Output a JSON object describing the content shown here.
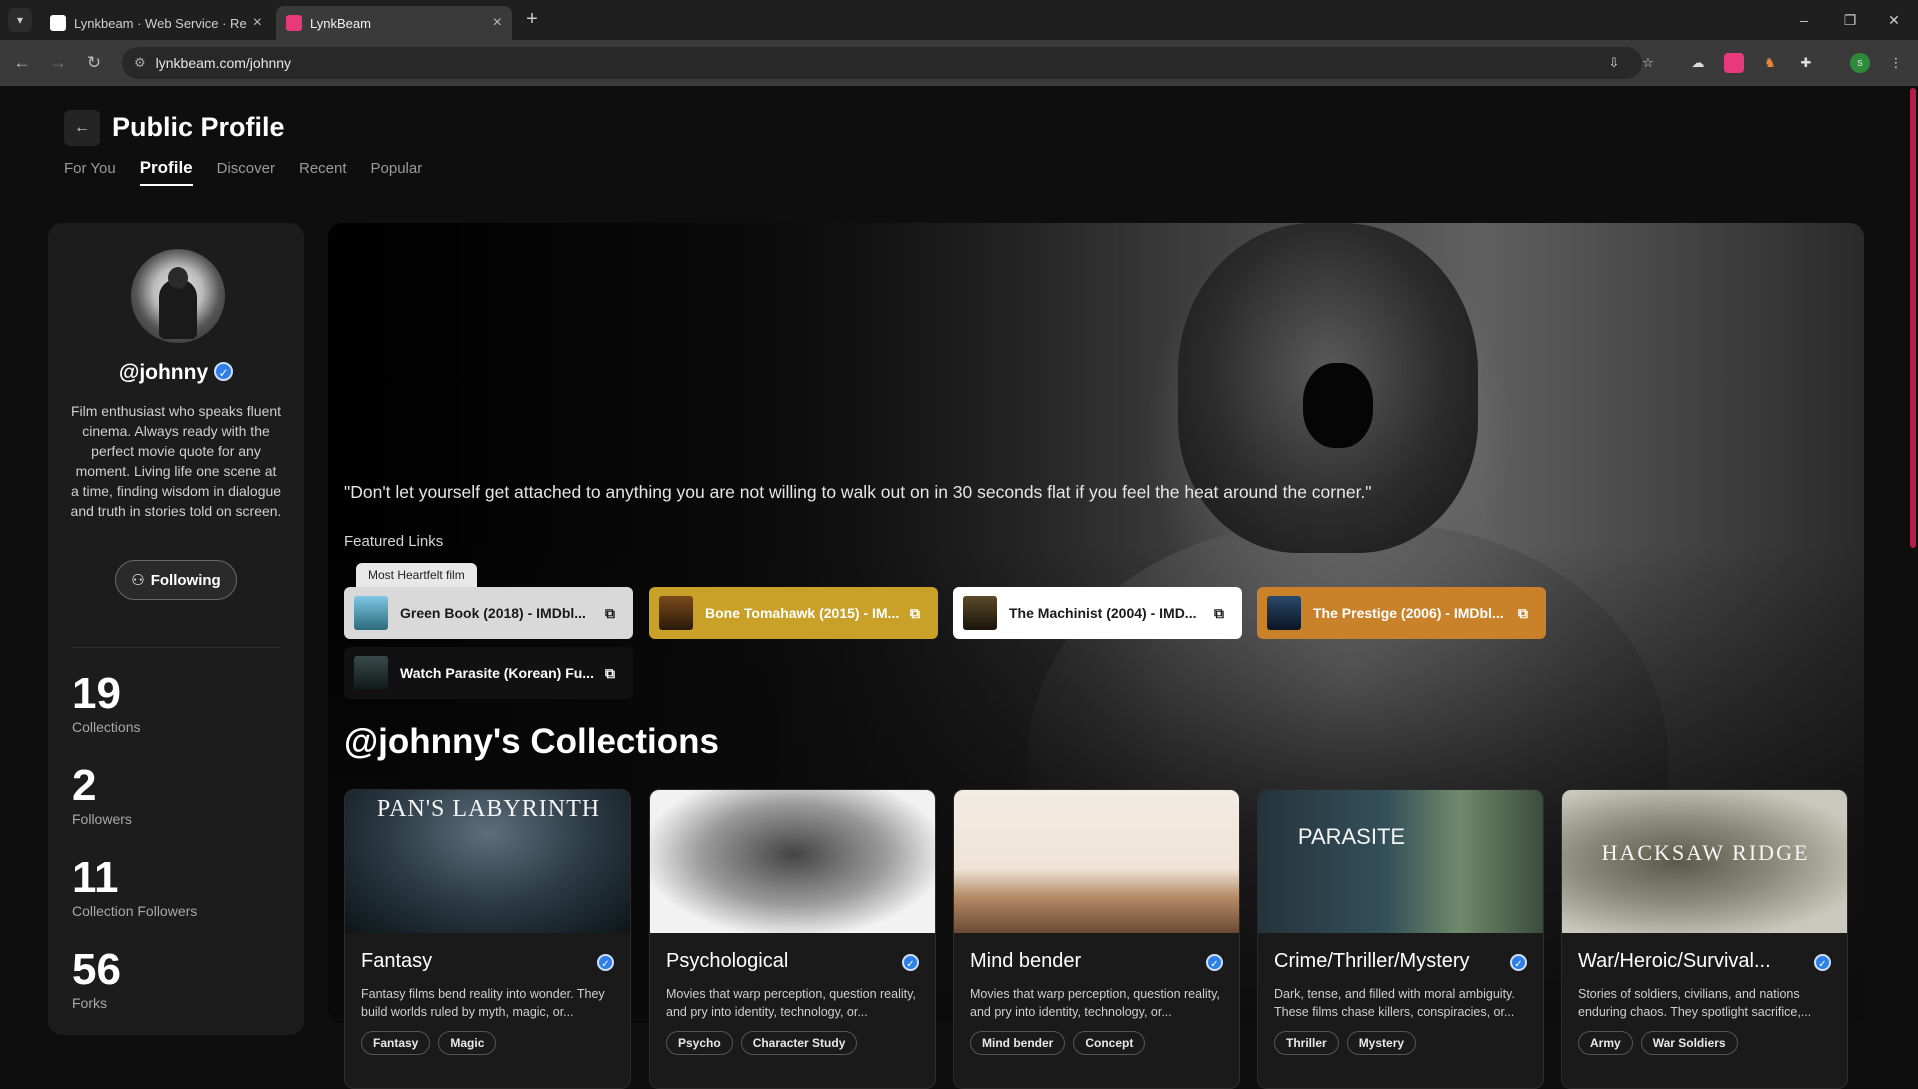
{
  "browser": {
    "tabs": [
      {
        "title": "Lynkbeam · Web Service · Ren",
        "active": false
      },
      {
        "title": "LynkBeam",
        "active": true
      }
    ],
    "url": "lynkbeam.com/johnny"
  },
  "header": {
    "title": "Public Profile",
    "nav": [
      "For You",
      "Profile",
      "Discover",
      "Recent",
      "Popular"
    ],
    "active_nav": "Profile"
  },
  "profile": {
    "handle": "@johnny",
    "bio": "Film enthusiast who speaks fluent cinema. Always ready with the perfect movie quote for any moment. Living life one scene at a time, finding wisdom in dialogue and truth in stories told on screen.",
    "follow_label": "Following",
    "stats": [
      {
        "value": "19",
        "label": "Collections"
      },
      {
        "value": "2",
        "label": "Followers"
      },
      {
        "value": "11",
        "label": "Collection Followers"
      },
      {
        "value": "56",
        "label": "Forks"
      }
    ]
  },
  "hero": {
    "quote": "\"Don't let yourself get attached to anything you are not willing to walk out on in 30 seconds flat if you feel the heat around the corner.\"",
    "featured_label": "Featured Links",
    "heartfelt_badge": "Most Heartfelt film",
    "links": [
      {
        "label": "Green Book (2018) - IMDbl...",
        "color": "#d9d9d9"
      },
      {
        "label": "Bone Tomahawk (2015) - IM...",
        "color": "#c9a028"
      },
      {
        "label": "The Machinist (2004) - IMD...",
        "color": "#ffffff"
      },
      {
        "label": "The Prestige (2006) - IMDbl...",
        "color": "#c9812a"
      },
      {
        "label": "Watch Parasite (Korean) Fu...",
        "color": "#111111"
      }
    ]
  },
  "collections": {
    "title": "@johnny's Collections",
    "items": [
      {
        "name": "Fantasy",
        "poster": "PAN'S LABYRINTH",
        "desc": "Fantasy films bend reality into wonder. They build worlds ruled by myth, magic, or...",
        "tags": [
          "Fantasy",
          "Magic"
        ]
      },
      {
        "name": "Psychological",
        "poster": "",
        "desc": "Movies that warp perception, question reality, and pry into identity, technology, or...",
        "tags": [
          "Psycho",
          "Character Study"
        ]
      },
      {
        "name": "Mind bender",
        "poster": "",
        "desc": "Movies that warp perception, question reality, and pry into identity, technology, or...",
        "tags": [
          "Mind bender",
          "Concept"
        ]
      },
      {
        "name": "Crime/Thriller/Mystery",
        "poster": "PARASITE",
        "desc": "Dark, tense, and filled with moral ambiguity. These films chase killers, conspiracies, or...",
        "tags": [
          "Thriller",
          "Mystery"
        ]
      },
      {
        "name": "War/Heroic/Survival...",
        "poster": "HACKSAW RIDGE",
        "desc": "Stories of soldiers, civilians, and nations enduring chaos. They spotlight sacrifice,...",
        "tags": [
          "Army",
          "War Soldiers"
        ]
      }
    ]
  }
}
